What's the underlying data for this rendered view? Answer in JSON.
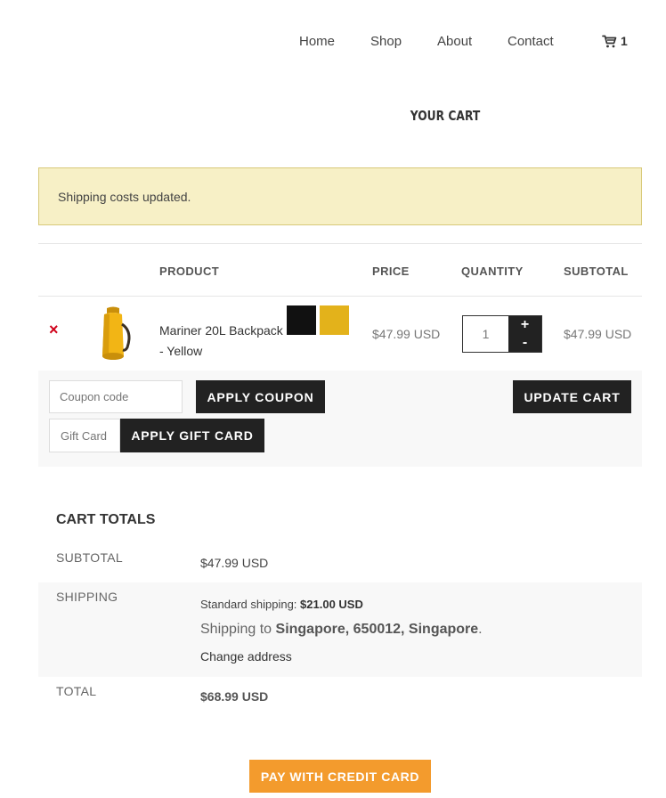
{
  "nav": {
    "items": [
      {
        "label": "Home"
      },
      {
        "label": "Shop"
      },
      {
        "label": "About"
      },
      {
        "label": "Contact"
      }
    ],
    "cart_count": "1"
  },
  "page_title": "YOUR CART",
  "notice": "Shipping costs updated.",
  "table": {
    "headers": {
      "product": "PRODUCT",
      "price": "PRICE",
      "quantity": "QUANTITY",
      "subtotal": "SUBTOTAL"
    },
    "rows": [
      {
        "remove": "×",
        "name": "Mariner 20L Backpack - Yellow",
        "swatch_colors": [
          "#111111",
          "#e3b21b"
        ],
        "price": "$47.99 USD",
        "quantity": "1",
        "subtotal": "$47.99 USD"
      }
    ]
  },
  "actions": {
    "coupon_placeholder": "Coupon code",
    "apply_coupon": "APPLY COUPON",
    "gift_placeholder": "Gift Card",
    "apply_gift": "APPLY GIFT CARD",
    "update_cart": "UPDATE CART",
    "qty_plus": "+",
    "qty_minus": "-"
  },
  "totals": {
    "title": "CART TOTALS",
    "subtotal_label": "SUBTOTAL",
    "subtotal_value": "$47.99 USD",
    "shipping_label": "SHIPPING",
    "shipping_method": "Standard shipping:",
    "shipping_cost": "$21.00 USD",
    "shipping_to_prefix": "Shipping to",
    "shipping_to_location": "Singapore, 650012, Singapore",
    "shipping_to_suffix": ".",
    "change_address": "Change address",
    "total_label": "TOTAL",
    "total_value": "$68.99 USD"
  },
  "pay_button": "PAY WITH CREDIT CARD",
  "colors": {
    "accent": "#f39b2d",
    "dark": "#222222",
    "notice_bg": "#f7f0c6",
    "remove": "#d0021b"
  }
}
